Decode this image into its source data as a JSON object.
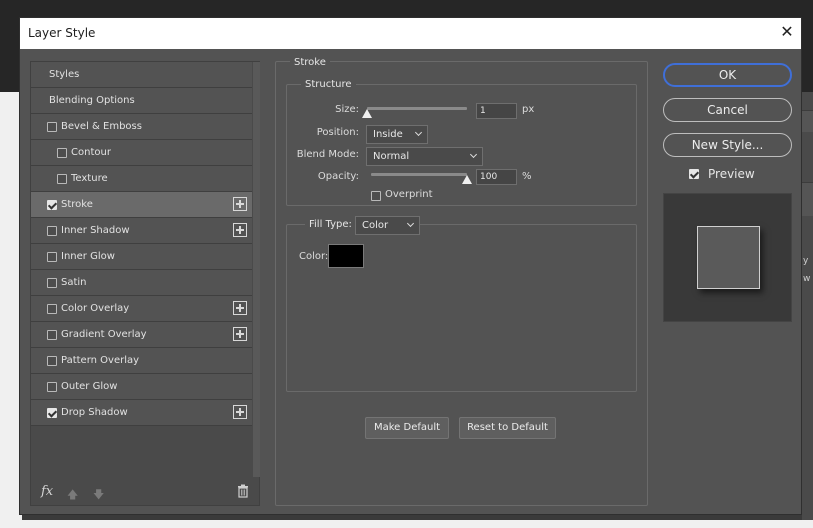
{
  "dialog": {
    "title": "Layer Style",
    "close_glyph": "✕"
  },
  "background": {
    "right_text_1": "y",
    "right_text_2": "w"
  },
  "style_list": {
    "items": [
      {
        "label": "Styles",
        "checkbox": false,
        "checked": false,
        "plus": false,
        "indent": 0,
        "selected": false
      },
      {
        "label": "Blending Options",
        "checkbox": false,
        "checked": false,
        "plus": false,
        "indent": 0,
        "selected": false
      },
      {
        "label": "Bevel & Emboss",
        "checkbox": true,
        "checked": false,
        "plus": false,
        "indent": 0,
        "selected": false
      },
      {
        "label": "Contour",
        "checkbox": true,
        "checked": false,
        "plus": false,
        "indent": 1,
        "selected": false
      },
      {
        "label": "Texture",
        "checkbox": true,
        "checked": false,
        "plus": false,
        "indent": 1,
        "selected": false
      },
      {
        "label": "Stroke",
        "checkbox": true,
        "checked": true,
        "plus": true,
        "indent": 0,
        "selected": true
      },
      {
        "label": "Inner Shadow",
        "checkbox": true,
        "checked": false,
        "plus": true,
        "indent": 0,
        "selected": false
      },
      {
        "label": "Inner Glow",
        "checkbox": true,
        "checked": false,
        "plus": false,
        "indent": 0,
        "selected": false
      },
      {
        "label": "Satin",
        "checkbox": true,
        "checked": false,
        "plus": false,
        "indent": 0,
        "selected": false
      },
      {
        "label": "Color Overlay",
        "checkbox": true,
        "checked": false,
        "plus": true,
        "indent": 0,
        "selected": false
      },
      {
        "label": "Gradient Overlay",
        "checkbox": true,
        "checked": false,
        "plus": true,
        "indent": 0,
        "selected": false
      },
      {
        "label": "Pattern Overlay",
        "checkbox": true,
        "checked": false,
        "plus": false,
        "indent": 0,
        "selected": false
      },
      {
        "label": "Outer Glow",
        "checkbox": true,
        "checked": false,
        "plus": false,
        "indent": 0,
        "selected": false
      },
      {
        "label": "Drop Shadow",
        "checkbox": true,
        "checked": true,
        "plus": true,
        "indent": 0,
        "selected": false
      }
    ],
    "fx_label": "fx",
    "up_glyph": "🡅",
    "down_glyph": "🡇"
  },
  "stroke": {
    "section_title": "Stroke",
    "structure_title": "Structure",
    "size_label": "Size:",
    "size_value": "1",
    "size_unit": "px",
    "size_fraction": 0.0,
    "position_label": "Position:",
    "position_value": "Inside",
    "blend_label": "Blend Mode:",
    "blend_value": "Normal",
    "opacity_label": "Opacity:",
    "opacity_value": "100",
    "opacity_unit": "%",
    "opacity_fraction": 1.0,
    "overprint_label": "Overprint",
    "fill_type_label": "Fill Type:",
    "fill_type_value": "Color",
    "color_label": "Color:",
    "color_value": "#000000",
    "make_default": "Make Default",
    "reset_default": "Reset to Default"
  },
  "actions": {
    "ok": "OK",
    "cancel": "Cancel",
    "new_style": "New Style...",
    "preview_label": "Preview",
    "preview_checked": true
  },
  "colors": {
    "accent": "#3f6fd8",
    "dialog_bg": "#535353",
    "selected_item": "#6a6a6a"
  }
}
